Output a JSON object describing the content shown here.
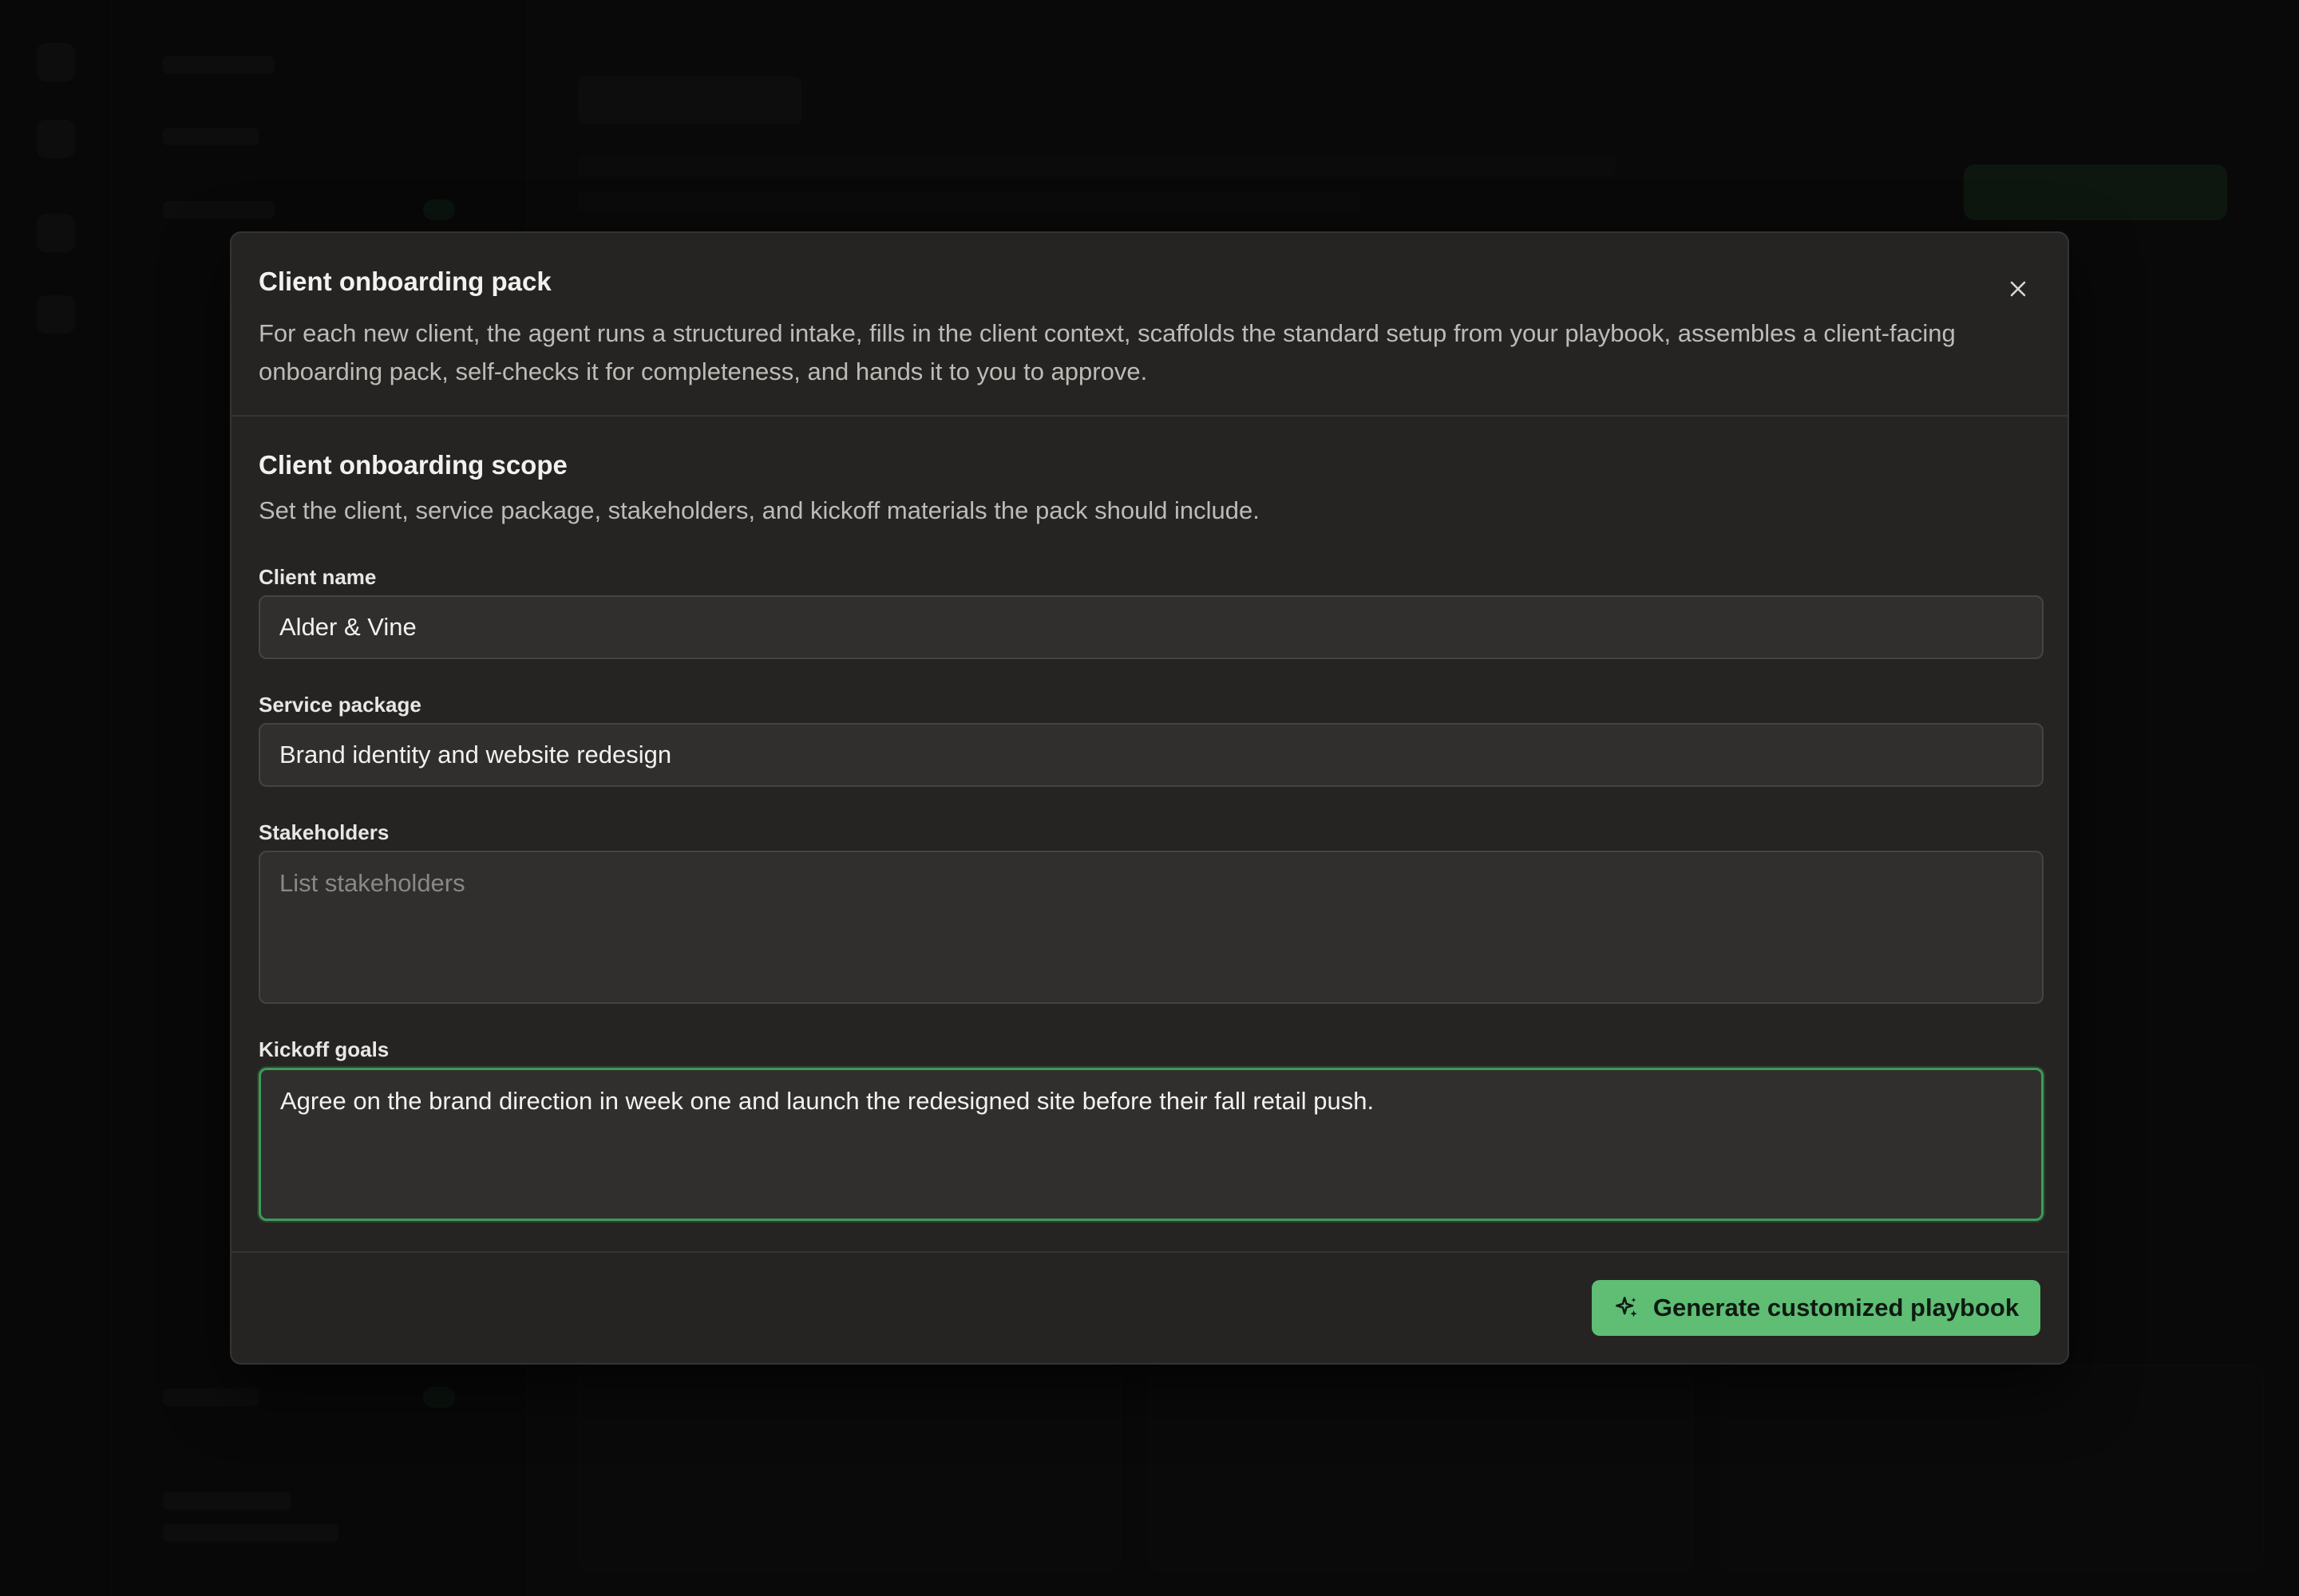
{
  "modal": {
    "title": "Client onboarding pack",
    "description": "For each new client, the agent runs a structured intake, fills in the client context, scaffolds the standard setup from your playbook, assembles a client-facing onboarding pack, self-checks it for completeness, and hands it to you to approve.",
    "close_icon": "close-icon",
    "section": {
      "title": "Client onboarding scope",
      "description": "Set the client, service package, stakeholders, and kickoff materials the pack should include."
    },
    "fields": {
      "client_name": {
        "label": "Client name",
        "value": "Alder & Vine"
      },
      "service_package": {
        "label": "Service package",
        "value": "Brand identity and website redesign"
      },
      "stakeholders": {
        "label": "Stakeholders",
        "value": "",
        "placeholder": "List stakeholders"
      },
      "kickoff_goals": {
        "label": "Kickoff goals",
        "value": "Agree on the brand direction in week one and launch the redesigned site before their fall retail push."
      }
    },
    "footer": {
      "generate_label": "Generate customized playbook",
      "generate_icon": "sparkles-icon"
    }
  },
  "colors": {
    "accent": "#5fbd74",
    "focus_border": "#3f9a58",
    "modal_bg": "#252423",
    "input_bg": "#302f2e"
  }
}
